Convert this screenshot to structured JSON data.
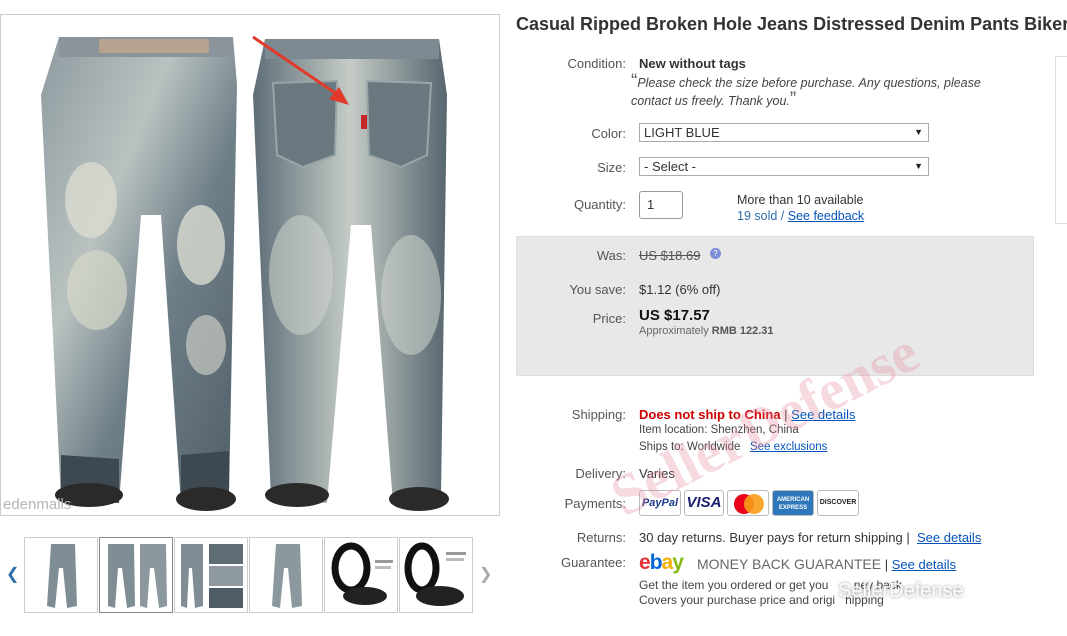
{
  "main_image": {
    "alt": "jeans product photo",
    "watermark": "edenmalls"
  },
  "thumbnails": {
    "count": 6,
    "selected_index": 1
  },
  "title": "Casual Ripped Broken Hole Jeans Distressed Denim Pants Biker",
  "condition": {
    "label": "Condition:",
    "value": "New without tags",
    "note": "Please check the size before purchase. Any questions, please contact us freely. Thank you."
  },
  "color": {
    "label": "Color:",
    "selected": "LIGHT BLUE"
  },
  "size": {
    "label": "Size:",
    "selected": "- Select -"
  },
  "quantity": {
    "label": "Quantity:",
    "value": "1",
    "available": "More than 10 available",
    "sold": "19 sold",
    "separator": " / ",
    "feedback_link": "See feedback"
  },
  "pricing": {
    "was_label": "Was:",
    "was_value": "US $18.69",
    "save_label": "You save:",
    "save_value": "$1.12 (6% off)",
    "price_label": "Price:",
    "price_value": "US $17.57",
    "approx_prefix": "Approximately",
    "approx_value": "RMB 122.31"
  },
  "shipping": {
    "label": "Shipping:",
    "status": "Does not ship to China",
    "sep": " | ",
    "details_link": "See details",
    "location": "Item location:  Shenzhen, China",
    "ships_to": "Ships to:  Worldwide",
    "exclusions_link": "See exclusions"
  },
  "delivery": {
    "label": "Delivery:",
    "value": "Varies"
  },
  "payments": {
    "label": "Payments:",
    "methods": [
      "PayPal",
      "VISA",
      "MasterCard",
      "AMERICAN EXPRESS",
      "DISCOVER"
    ]
  },
  "returns": {
    "label": "Returns:",
    "value": "30 day returns. Buyer pays for return shipping",
    "sep": " | ",
    "details_link": "See details"
  },
  "guarantee": {
    "label": "Guarantee:",
    "logo_letters": [
      "e",
      "b",
      "a",
      "y"
    ],
    "money_back": "MONEY BACK GUARANTEE",
    "sep": " | ",
    "details_link": "See details",
    "line1": "Get the item you ordered or get you",
    "line1_tail": "ney back",
    "line2": "Covers your purchase price and origi",
    "line2_tail": "hipping"
  },
  "watermarks": {
    "diagonal": "SellerDefense",
    "corner": "SellerDefense"
  },
  "colors": {
    "link": "#0654ba",
    "warning": "#cc0000",
    "price_box": "#e8e8e8",
    "ebay_e": "#e53238",
    "ebay_b": "#0064d2",
    "ebay_a": "#f5af02",
    "ebay_y": "#86b817"
  }
}
